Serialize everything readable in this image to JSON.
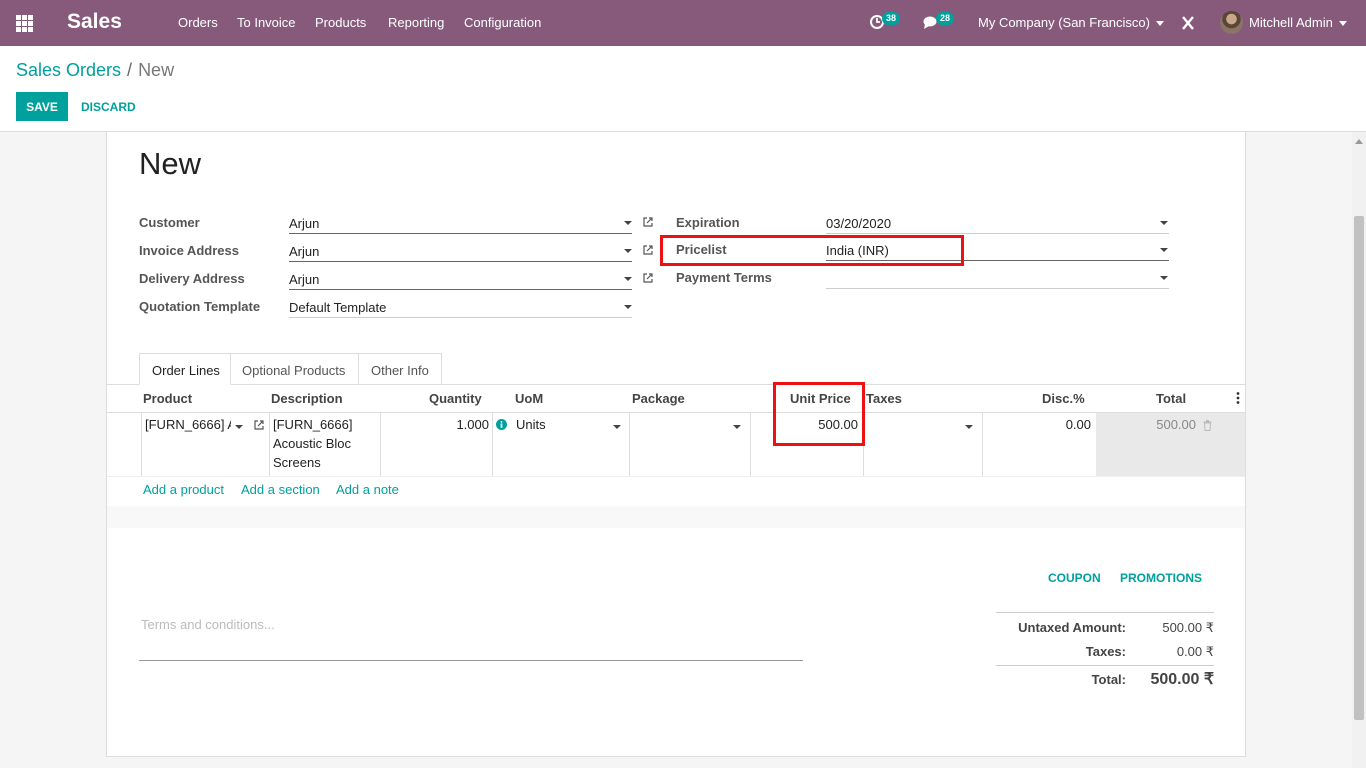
{
  "topbar": {
    "app_name": "Sales",
    "menu": [
      "Orders",
      "To Invoice",
      "Products",
      "Reporting",
      "Configuration"
    ],
    "activity_count": "38",
    "messages_count": "28",
    "company": "My Company (San Francisco)",
    "user": "Mitchell Admin"
  },
  "breadcrumb": {
    "parent": "Sales Orders",
    "separator": "/",
    "current": "New"
  },
  "buttons": {
    "save": "SAVE",
    "discard": "DISCARD"
  },
  "form": {
    "title": "New",
    "left": [
      {
        "label": "Customer",
        "value": "Arjun"
      },
      {
        "label": "Invoice Address",
        "value": "Arjun"
      },
      {
        "label": "Delivery Address",
        "value": "Arjun"
      },
      {
        "label": "Quotation Template",
        "value": "Default Template"
      }
    ],
    "right": [
      {
        "label": "Expiration",
        "value": "03/20/2020"
      },
      {
        "label": "Pricelist",
        "value": "India (INR)"
      },
      {
        "label": "Payment Terms",
        "value": ""
      }
    ]
  },
  "tabs": [
    "Order Lines",
    "Optional Products",
    "Other Info"
  ],
  "table": {
    "headers": [
      "Product",
      "Description",
      "Quantity",
      "UoM",
      "Package",
      "Unit Price",
      "Taxes",
      "Disc.%",
      "Total"
    ],
    "row": {
      "product": "[FURN_6666] A",
      "description_lines": [
        "[FURN_6666]",
        "Acoustic Bloc",
        "Screens"
      ],
      "quantity": "1.000",
      "uom": "Units",
      "package": "",
      "unit_price": "500.00",
      "taxes": "",
      "discount": "0.00",
      "total": "500.00"
    },
    "actions": [
      "Add a product",
      "Add a section",
      "Add a note"
    ]
  },
  "footer": {
    "coupon": "COUPON",
    "promotions": "PROMOTIONS",
    "terms_placeholder": "Terms and conditions...",
    "untaxed_label": "Untaxed Amount:",
    "untaxed_value": "500.00 ₹",
    "taxes_label": "Taxes:",
    "taxes_value": "0.00 ₹",
    "total_label": "Total:",
    "total_value": "500.00 ₹"
  },
  "colors": {
    "brand": "#875a7b",
    "accent": "#00a09d",
    "highlight": "#e11111"
  },
  "icons": [
    "apps-grid-icon",
    "activity-clock-icon",
    "chat-bubble-icon",
    "debug-tools-icon",
    "external-link-icon",
    "info-circle-icon",
    "trash-icon",
    "kebab-menu-icon"
  ]
}
